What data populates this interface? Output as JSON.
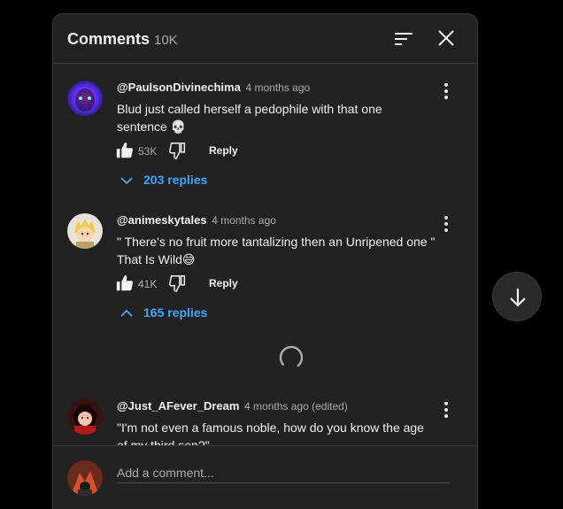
{
  "header": {
    "title": "Comments",
    "count": "10K"
  },
  "comments": [
    {
      "author": "@PaulsonDivinechima",
      "time": "4 months ago",
      "text": "Blud just called herself a pedophile with that one sentence 💀",
      "likes": "53K",
      "reply_label": "Reply",
      "replies_label": "203 replies",
      "replies_icon": "chevron-down-icon"
    },
    {
      "author": "@animeskytales",
      "time": "4 months ago",
      "text": "\" There's no fruit more tantalizing then an  Unripened one \" That Is Wild😅",
      "likes": "41K",
      "reply_label": "Reply",
      "replies_label": "165 replies",
      "replies_icon": "chevron-up-icon"
    },
    {
      "author": "@Just_AFever_Dream",
      "time": "4 months ago (edited)",
      "text": "\"I'm not even a famous noble, how do you know the age of my third son?\""
    }
  ],
  "footer": {
    "placeholder": "Add a comment..."
  },
  "colors": {
    "panel": "#212121",
    "link": "#3ea6ff",
    "muted": "#aaaaaa",
    "text": "#f1f1f1"
  }
}
